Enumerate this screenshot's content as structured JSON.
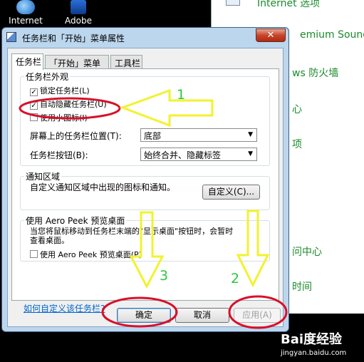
{
  "desktop": {
    "icons": [
      {
        "label": "Internet"
      },
      {
        "label": "Adobe"
      }
    ]
  },
  "control_panel": {
    "items": [
      {
        "label": "Internet 选项"
      },
      {
        "label": "emium Sound"
      },
      {
        "label": "ws 防火墙"
      },
      {
        "label": "心"
      },
      {
        "label": "项"
      },
      {
        "label": "问中心"
      },
      {
        "label": "时间"
      }
    ]
  },
  "dialog": {
    "title": "任务栏和「开始」菜单属性",
    "close_label": "✕",
    "tabs": [
      {
        "label": "任务栏",
        "active": true
      },
      {
        "label": "「开始」菜单",
        "active": false
      },
      {
        "label": "工具栏",
        "active": false
      }
    ],
    "appearance": {
      "title": "任务栏外观",
      "lock_taskbar": {
        "label": "锁定任务栏(L)",
        "checked": true
      },
      "auto_hide": {
        "label": "自动隐藏任务栏(U)",
        "checked": true
      },
      "small_icons": {
        "label": "使用小图标(I)",
        "checked": false
      },
      "location_label": "屏幕上的任务栏位置(T):",
      "location_value": "底部",
      "buttons_label": "任务栏按钮(B):",
      "buttons_value": "始终合并、隐藏标签"
    },
    "notification": {
      "title": "通知区域",
      "description": "自定义通知区域中出现的图标和通知。",
      "customize_label": "自定义(C)..."
    },
    "aero_peek": {
      "title": "使用 Aero Peek 预览桌面",
      "description_line1": "当您将鼠标移动到任务栏末端的\"显示桌面\"按钮时，会暂时",
      "description_line2": "查看桌面。",
      "checkbox": {
        "label": "使用 Aero Peek 预览桌面(P)",
        "checked": false
      }
    },
    "help_link": "如何自定义该任务栏?",
    "buttons": {
      "ok": "确定",
      "cancel": "取消",
      "apply": "应用(A)"
    }
  },
  "annotations": {
    "step1": "1",
    "step2": "2",
    "step3": "3",
    "color_yellow": "#f2f230",
    "color_red": "#d8102a"
  },
  "watermark": {
    "logo": "Bai度经验",
    "url": "jingyan.baidu.com"
  }
}
